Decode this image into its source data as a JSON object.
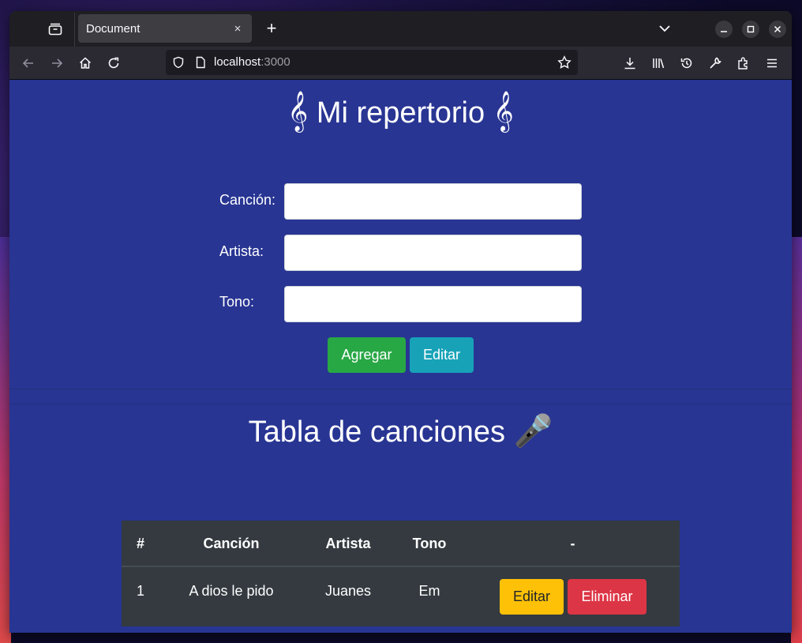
{
  "browser": {
    "tab_title": "Document",
    "tab_close": "×",
    "new_tab": "+",
    "url_host": "localhost",
    "url_port": ":3000"
  },
  "page": {
    "title": "Mi repertorio",
    "clef_glyph": "𝄞",
    "form": {
      "song_label": "Canción:",
      "artist_label": "Artista:",
      "key_label": "Tono:",
      "song_value": "",
      "artist_value": "",
      "key_value": "",
      "add_button": "Agregar",
      "edit_button": "Editar"
    },
    "table_title": "Tabla de canciones",
    "mic_glyph": "🎤",
    "table": {
      "headers": [
        "#",
        "Canción",
        "Artista",
        "Tono",
        "-"
      ],
      "rows": [
        {
          "num": "1",
          "song": "A dios le pido",
          "artist": "Juanes",
          "key": "Em",
          "edit": "Editar",
          "delete": "Eliminar"
        }
      ]
    }
  },
  "colors": {
    "page_bg": "#283593",
    "add_btn": "#28a745",
    "edit_btn": "#17a2b8",
    "row_edit_btn": "#ffc107",
    "delete_btn": "#dc3545",
    "table_bg": "#343a40"
  }
}
